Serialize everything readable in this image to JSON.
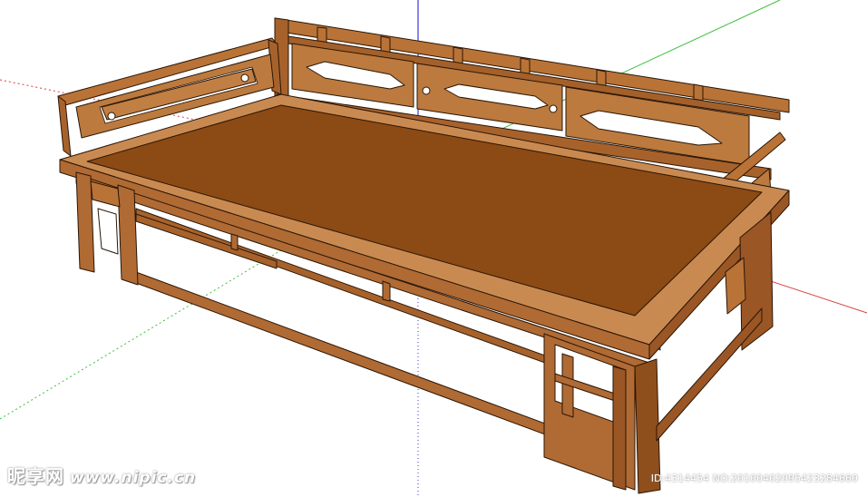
{
  "watermark": {
    "site_name": "昵享网",
    "site_url": "www.nipic.cn",
    "image_id": "ID:4314454 NO:20100402095423284660"
  },
  "colors": {
    "wood": "#b06a34",
    "wood_light": "#c98a52",
    "wood_dark": "#7a4418",
    "seat": "#8c4a14",
    "axis_red": "#d94040",
    "axis_green": "#3fbf3f",
    "axis_blue": "#3a3ad0"
  }
}
